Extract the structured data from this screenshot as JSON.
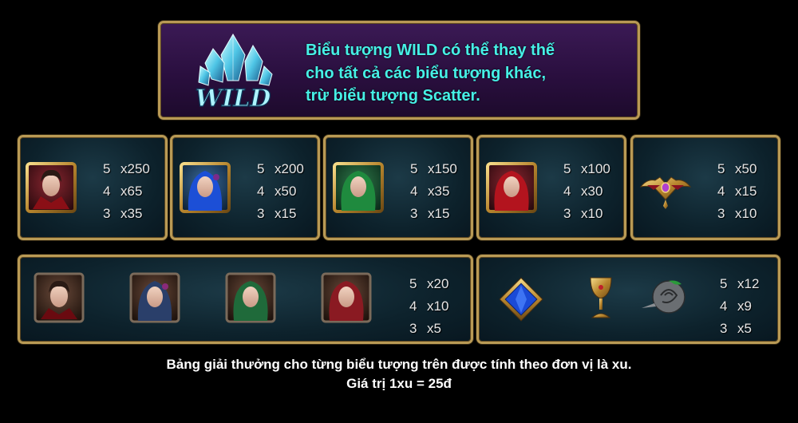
{
  "wild": {
    "logo_text": "WILD",
    "lines": [
      "Biểu tượng WILD có thể thay thế",
      "cho tất cả các biểu tượng khác,",
      "trừ biểu tượng Scatter."
    ]
  },
  "top_row": [
    {
      "symbol": "vampire-man",
      "pays": [
        {
          "n": "5",
          "v": "x250"
        },
        {
          "n": "4",
          "v": "x65"
        },
        {
          "n": "3",
          "v": "x35"
        }
      ]
    },
    {
      "symbol": "blue-hair-woman",
      "pays": [
        {
          "n": "5",
          "v": "x200"
        },
        {
          "n": "4",
          "v": "x50"
        },
        {
          "n": "3",
          "v": "x15"
        }
      ]
    },
    {
      "symbol": "green-hair-woman",
      "pays": [
        {
          "n": "5",
          "v": "x150"
        },
        {
          "n": "4",
          "v": "x35"
        },
        {
          "n": "3",
          "v": "x15"
        }
      ]
    },
    {
      "symbol": "red-hair-woman",
      "pays": [
        {
          "n": "5",
          "v": "x100"
        },
        {
          "n": "4",
          "v": "x30"
        },
        {
          "n": "3",
          "v": "x10"
        }
      ]
    },
    {
      "symbol": "bat-amulet",
      "pays": [
        {
          "n": "5",
          "v": "x50"
        },
        {
          "n": "4",
          "v": "x15"
        },
        {
          "n": "3",
          "v": "x10"
        }
      ]
    }
  ],
  "bottom_left": {
    "symbols": [
      "vampire-man",
      "blue-hair-woman",
      "green-hair-woman",
      "red-hair-woman"
    ],
    "pays": [
      {
        "n": "5",
        "v": "x20"
      },
      {
        "n": "4",
        "v": "x10"
      },
      {
        "n": "3",
        "v": "x5"
      }
    ]
  },
  "bottom_right": {
    "symbols": [
      "sapphire-brooch",
      "golden-chalice",
      "stone-rose"
    ],
    "pays": [
      {
        "n": "5",
        "v": "x12"
      },
      {
        "n": "4",
        "v": "x9"
      },
      {
        "n": "3",
        "v": "x5"
      }
    ]
  },
  "footer": {
    "line1": "Bảng giải thưởng cho từng biểu tượng trên được tính theo đơn vị là xu.",
    "line2": "Giá trị 1xu = 25đ"
  }
}
